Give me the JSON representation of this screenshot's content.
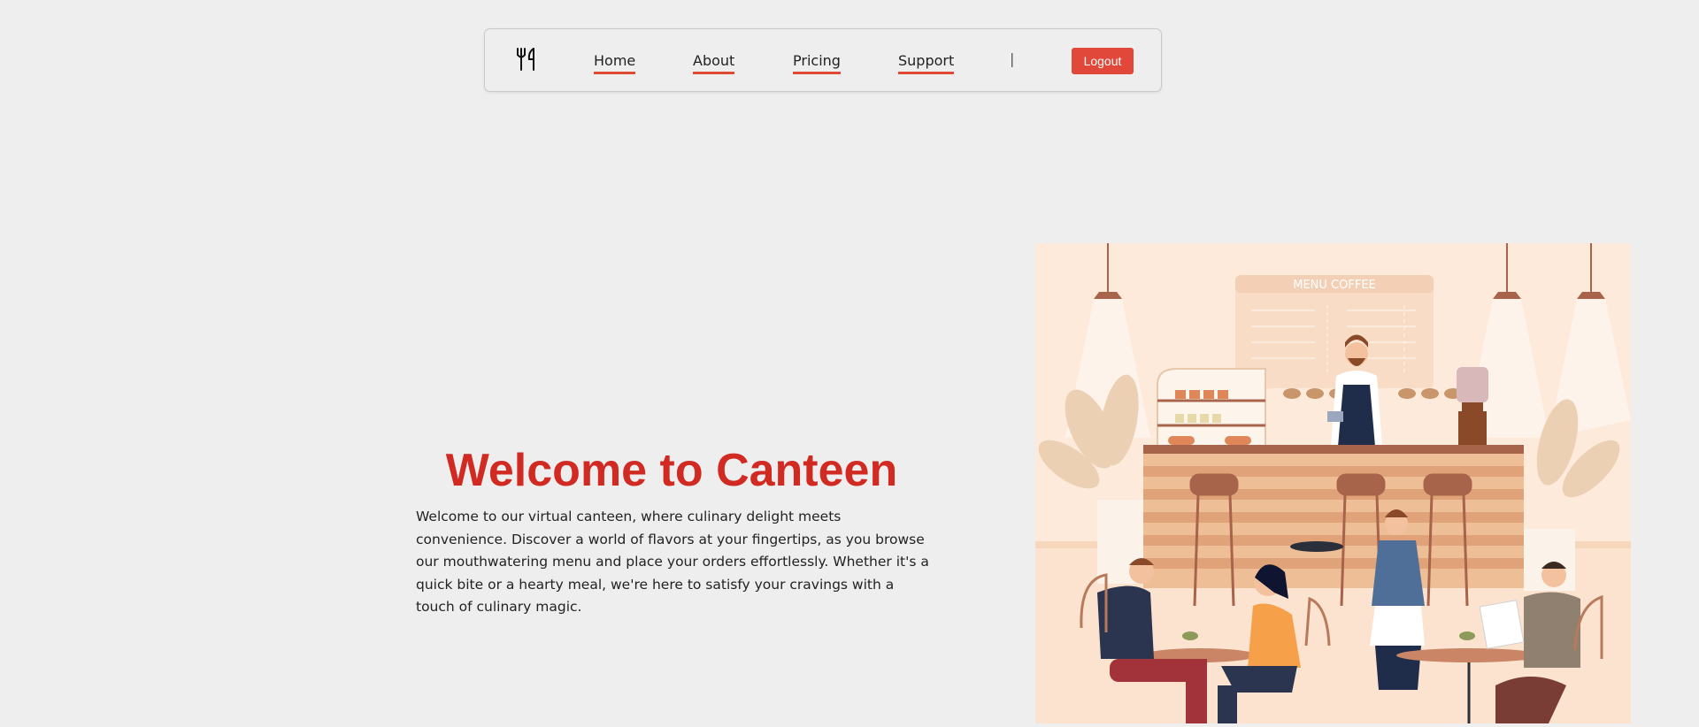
{
  "nav": {
    "logo_icon": "fork-knife-icon",
    "links": [
      {
        "label": "Home"
      },
      {
        "label": "About"
      },
      {
        "label": "Pricing"
      },
      {
        "label": "Support"
      }
    ],
    "divider": "|",
    "logout_label": "Logout"
  },
  "hero": {
    "title": "Welcome to Canteen",
    "description": "Welcome to our virtual canteen, where culinary delight meets convenience. Discover a world of flavors at your fingertips, as you browse our mouthwatering menu and place your orders effortlessly. Whether it's a quick bite or a hearty meal, we're here to satisfy your cravings with a touch of culinary magic."
  },
  "illustration": {
    "menu_board_title": "MENU COFFEE"
  },
  "colors": {
    "accent": "#d02a22",
    "button": "#e2483a",
    "underline": "#e04a32",
    "background": "#eeeeee"
  }
}
